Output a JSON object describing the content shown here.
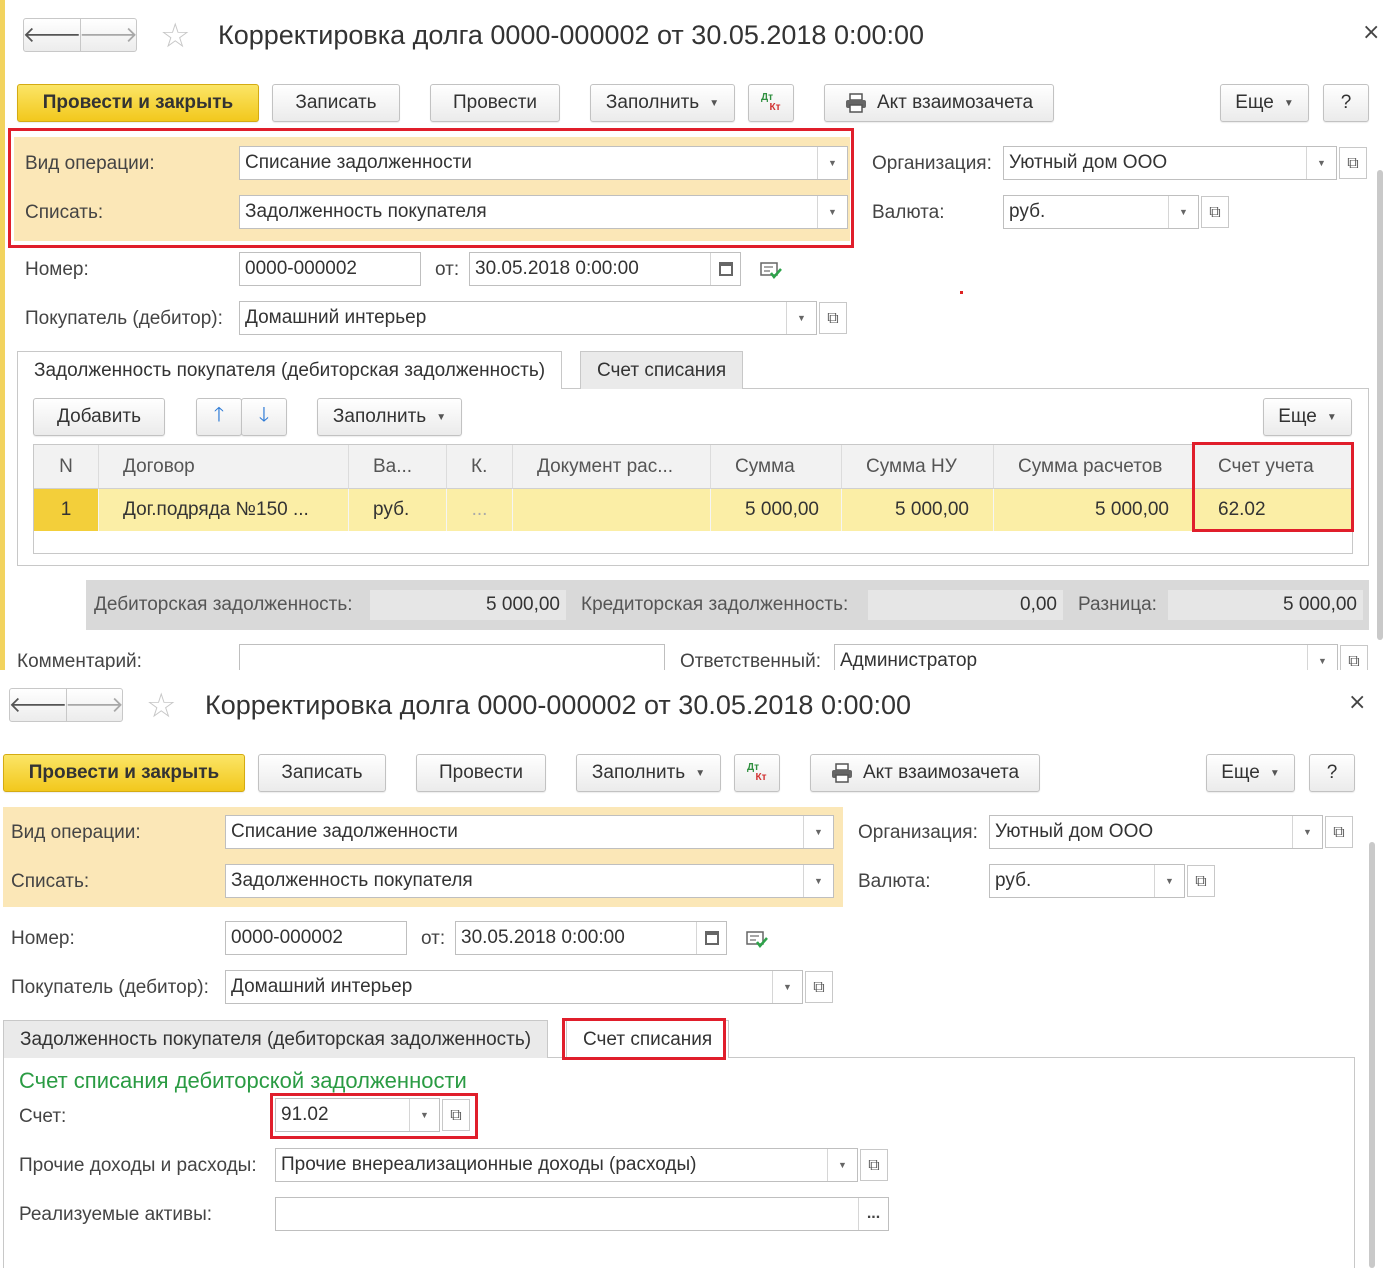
{
  "window": {
    "title": "Корректировка долга 0000-000002 от 30.05.2018 0:00:00",
    "close_glyph": "×"
  },
  "nav": {
    "back_glyph": "🡐",
    "forward_glyph": "🡒",
    "star_glyph": "☆"
  },
  "toolbar": {
    "post_and_close": "Провести и закрыть",
    "save": "Записать",
    "post": "Провести",
    "fill": "Заполнить",
    "dtkt_top": "Дт",
    "dtkt_bottom": "Кт",
    "offset_act": "Акт взаимозачета",
    "more": "Еще",
    "help": "?"
  },
  "form": {
    "operation_label": "Вид операции:",
    "operation_value": "Списание задолженности",
    "writeoff_label": "Списать:",
    "writeoff_value": "Задолженность покупателя",
    "org_label": "Организация:",
    "org_value": "Уютный дом ООО",
    "currency_label": "Валюта:",
    "currency_value": "руб.",
    "number_label": "Номер:",
    "number_value": "0000-000002",
    "date_label": "от:",
    "date_value": "30.05.2018  0:00:00",
    "buyer_label": "Покупатель (дебитор):",
    "buyer_value": "Домашний интерьер",
    "comment_label": "Комментарий:",
    "responsible_label": "Ответственный:",
    "responsible_value": "Администратор"
  },
  "tabs": {
    "receivables": "Задолженность покупателя (дебиторская задолженность)",
    "writeoff_account": "Счет списания"
  },
  "table_toolbar": {
    "add": "Добавить",
    "up_glyph": "🡑",
    "down_glyph": "🡓",
    "fill": "Заполнить",
    "more": "Еще"
  },
  "table": {
    "columns": [
      "N",
      "Договор",
      "Ва...",
      "К.",
      "Документ рас...",
      "Сумма",
      "Сумма НУ",
      "Сумма расчетов",
      "Счет учета"
    ],
    "rows": [
      [
        "1",
        "Дог.подряда №150 ...",
        "руб.",
        "...",
        "",
        "5 000,00",
        "5 000,00",
        "5 000,00",
        "62.02"
      ]
    ]
  },
  "totals": {
    "receivable_label": "Дебиторская задолженность:",
    "receivable_value": "5 000,00",
    "payable_label": "Кредиторская задолженность:",
    "payable_value": "0,00",
    "diff_label": "Разница:",
    "diff_value": "5 000,00"
  },
  "writeoff_section": {
    "title": "Счет списания дебиторской задолженности",
    "account_label": "Счет:",
    "account_value": "91.02",
    "other_label": "Прочие доходы и расходы:",
    "other_value": "Прочие внереализационные доходы (расходы)",
    "assets_label": "Реализуемые активы:",
    "assets_value": "",
    "dots": "..."
  },
  "colors": {
    "primary_button": "#f2c81d",
    "highlight_area": "#fbe7b7",
    "selected_row": "#fbeea6",
    "annotation_red": "#e01e2b",
    "section_title_green": "#2a9b43"
  }
}
